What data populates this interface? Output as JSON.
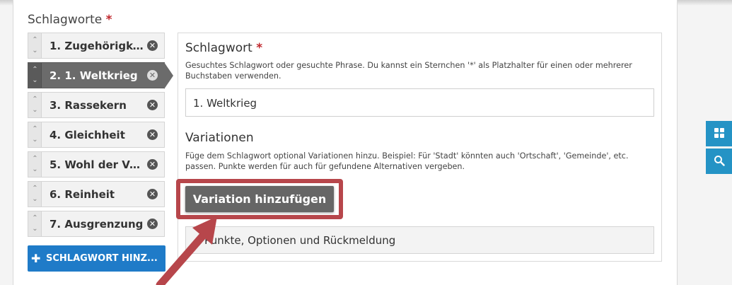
{
  "section": {
    "title": "Schlagworte",
    "required_mark": "*"
  },
  "keywords": [
    {
      "label": "1. Zugehörigkeit...",
      "active": false
    },
    {
      "label": "2. 1. Weltkrieg",
      "active": true
    },
    {
      "label": "3. Rassekern",
      "active": false
    },
    {
      "label": "4. Gleichheit",
      "active": false
    },
    {
      "label": "5. Wohl der Volk...",
      "active": false
    },
    {
      "label": "6. Reinheit",
      "active": false
    },
    {
      "label": "7. Ausgrenzung",
      "active": false
    }
  ],
  "add_keyword": {
    "icon": "plus-icon",
    "label": "SCHLAGWORT HINZ..."
  },
  "detail": {
    "keyword_title": "Schlagwort",
    "required_mark": "*",
    "keyword_help": "Gesuchtes Schlagwort oder gesuchte Phrase. Du kannst ein Sternchen '*' als Platzhalter für einen oder mehrerer Buchstaben verwenden.",
    "keyword_value": "1. Weltkrieg",
    "variations_title": "Variationen",
    "variations_help": "Füge dem Schlagwort optional Variationen hinzu. Beispiel: Für 'Stadt' könnten auch 'Ortschaft', 'Gemeinde', etc. passen. Punkte werden für auch für gefundene Alternativen vergeben.",
    "add_variation_label": "Variation hinzufügen",
    "collapsed_section_label": "Punkte, Optionen und Rückmeldung"
  },
  "side_tabs": [
    "grid-icon",
    "search-icon"
  ],
  "colors": {
    "accent_blue": "#1f7bc8",
    "side_tab_blue": "#2493c5",
    "highlight_red": "#b7464b",
    "required_red": "#c0272d"
  }
}
